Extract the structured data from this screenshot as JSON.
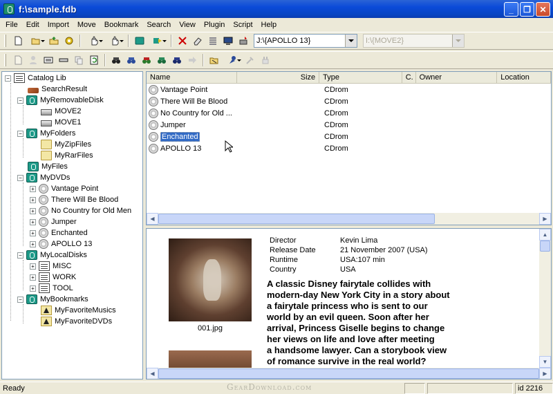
{
  "window": {
    "title": "f:\\sample.fdb"
  },
  "menu": [
    "File",
    "Edit",
    "Import",
    "Move",
    "Bookmark",
    "Search",
    "View",
    "Plugin",
    "Script",
    "Help"
  ],
  "toolbar": {
    "path_combo_value": "J:\\{APOLLO 13}",
    "move_combo_value": "I:\\{MOVE2}"
  },
  "tree": {
    "root": "Catalog Lib",
    "search_result": "SearchResult",
    "removable": {
      "label": "MyRemovableDisk",
      "children": [
        "MOVE2",
        "MOVE1"
      ]
    },
    "folders": {
      "label": "MyFolders",
      "children": [
        "MyZipFiles",
        "MyRarFiles"
      ]
    },
    "files": "MyFiles",
    "dvds": {
      "label": "MyDVDs",
      "children": [
        "Vantage Point",
        "There Will Be Blood",
        "No Country for Old Men",
        "Jumper",
        "Enchanted",
        "APOLLO 13"
      ]
    },
    "local": {
      "label": "MyLocalDisks",
      "children": [
        "MISC",
        "WORK",
        "TOOL"
      ]
    },
    "bookmarks": {
      "label": "MyBookmarks",
      "children": [
        "MyFavoriteMusics",
        "MyFavoriteDVDs"
      ]
    }
  },
  "list": {
    "columns": [
      "Name",
      "Size",
      "Type",
      "C.",
      "Owner",
      "Location"
    ],
    "rows": [
      {
        "name": "Vantage Point",
        "type": "CDrom"
      },
      {
        "name": "There Will Be Blood",
        "type": "CDrom"
      },
      {
        "name": "No Country for Old ...",
        "type": "CDrom"
      },
      {
        "name": "Jumper",
        "type": "CDrom"
      },
      {
        "name": "Enchanted",
        "type": "CDrom"
      },
      {
        "name": "APOLLO 13",
        "type": "CDrom"
      }
    ],
    "selected_index": 4
  },
  "detail": {
    "image_caption": "001.jpg",
    "fields": [
      {
        "key": "Director",
        "value": "Kevin Lima"
      },
      {
        "key": "Release Date",
        "value": "21 November 2007 (USA)"
      },
      {
        "key": "Runtime",
        "value": "USA:107 min"
      },
      {
        "key": "Country",
        "value": "USA"
      }
    ],
    "synopsis": "A classic Disney fairytale collides with\nmodern-day New York City in a story about\na fairytale princess who is sent to our\nworld by an evil queen. Soon after her\narrival, Princess Giselle begins to change\n her views on life and love after meeting\n a handsome lawyer. Can a storybook view\n of romance survive in the real world?"
  },
  "status": {
    "text": "Ready",
    "id_text": "id 2216"
  },
  "watermark": "GearDownload.com"
}
